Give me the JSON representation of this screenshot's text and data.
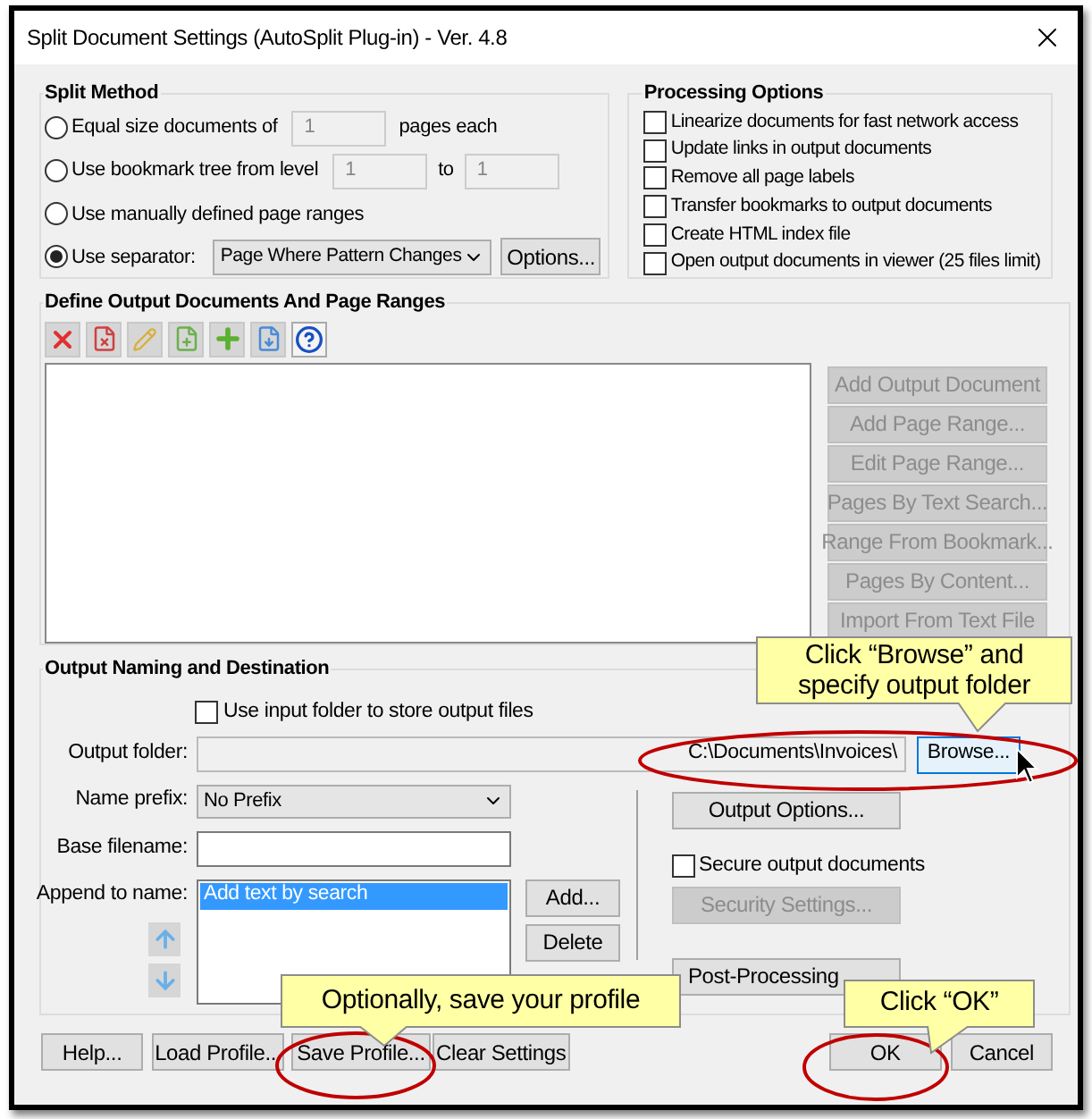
{
  "window": {
    "title": "Split Document Settings (AutoSplit Plug-in) - Ver. 4.8"
  },
  "split_method": {
    "title": "Split Method",
    "options": [
      {
        "kind": "pages",
        "label": "Equal size documents of",
        "selected": false,
        "value": "1",
        "suffix": "pages each"
      },
      {
        "kind": "levels",
        "label": "Use bookmark tree from level",
        "selected": false,
        "from": "1",
        "to_label": "to",
        "to": "1"
      },
      {
        "kind": "plain",
        "label": "Use manually defined page ranges",
        "selected": false
      },
      {
        "kind": "separator",
        "label": "Use separator:",
        "selected": true,
        "dropdown": "Page Where Pattern Changes",
        "button": "Options..."
      }
    ]
  },
  "processing_options": {
    "title": "Processing Options",
    "items": [
      {
        "label": "Linearize documents for fast network access",
        "checked": false
      },
      {
        "label": "Update links in output documents",
        "checked": false
      },
      {
        "label": "Remove all page labels",
        "checked": false
      },
      {
        "label": "Transfer bookmarks to output documents",
        "checked": false
      },
      {
        "label": "Create HTML index file",
        "checked": false
      },
      {
        "label": "Open output documents in viewer (25 files limit)",
        "checked": false
      }
    ]
  },
  "define_output": {
    "title": "Define Output Documents And Page Ranges",
    "buttons": [
      {
        "label": "Add Output Document",
        "disabled": true
      },
      {
        "label": "Add Page Range...",
        "disabled": true
      },
      {
        "label": "Edit Page Range...",
        "disabled": true
      },
      {
        "label": "Pages By Text Search...",
        "disabled": true
      },
      {
        "label": "Range From Bookmark...",
        "disabled": true
      },
      {
        "label": "Pages By Content...",
        "disabled": true
      },
      {
        "label": "Import From Text File",
        "disabled": true
      }
    ]
  },
  "output_naming": {
    "title": "Output Naming and Destination",
    "use_input_folder": {
      "label": "Use input folder to store output files",
      "checked": false
    },
    "output_folder": {
      "label": "Output folder:",
      "value": "C:\\Documents\\Invoices\\"
    },
    "browse_button": "Browse...",
    "name_prefix": {
      "label": "Name prefix:",
      "value": "No Prefix"
    },
    "base_filename": {
      "label": "Base filename:"
    },
    "append_to_name": {
      "label": "Append to name:",
      "items": [
        {
          "label": "Add text by search",
          "selected": true
        }
      ]
    },
    "add_button": "Add...",
    "delete_button": "Delete",
    "output_options_button": "Output Options...",
    "secure": {
      "label": "Secure output documents",
      "checked": false
    },
    "security_settings": {
      "label": "Security Settings...",
      "disabled": true
    },
    "post_processing_button": "Post-Processing"
  },
  "bottom_buttons": [
    {
      "label": "Help..."
    },
    {
      "label": "Load Profile..."
    },
    {
      "label": "Save Profile..."
    },
    {
      "label": "Clear Settings"
    },
    {
      "label": "OK"
    },
    {
      "label": "Cancel"
    }
  ],
  "callouts": [
    {
      "text": "Click “Browse” and specify output folder"
    },
    {
      "text": "Optionally, save your profile"
    },
    {
      "text": "Click “OK”"
    }
  ]
}
